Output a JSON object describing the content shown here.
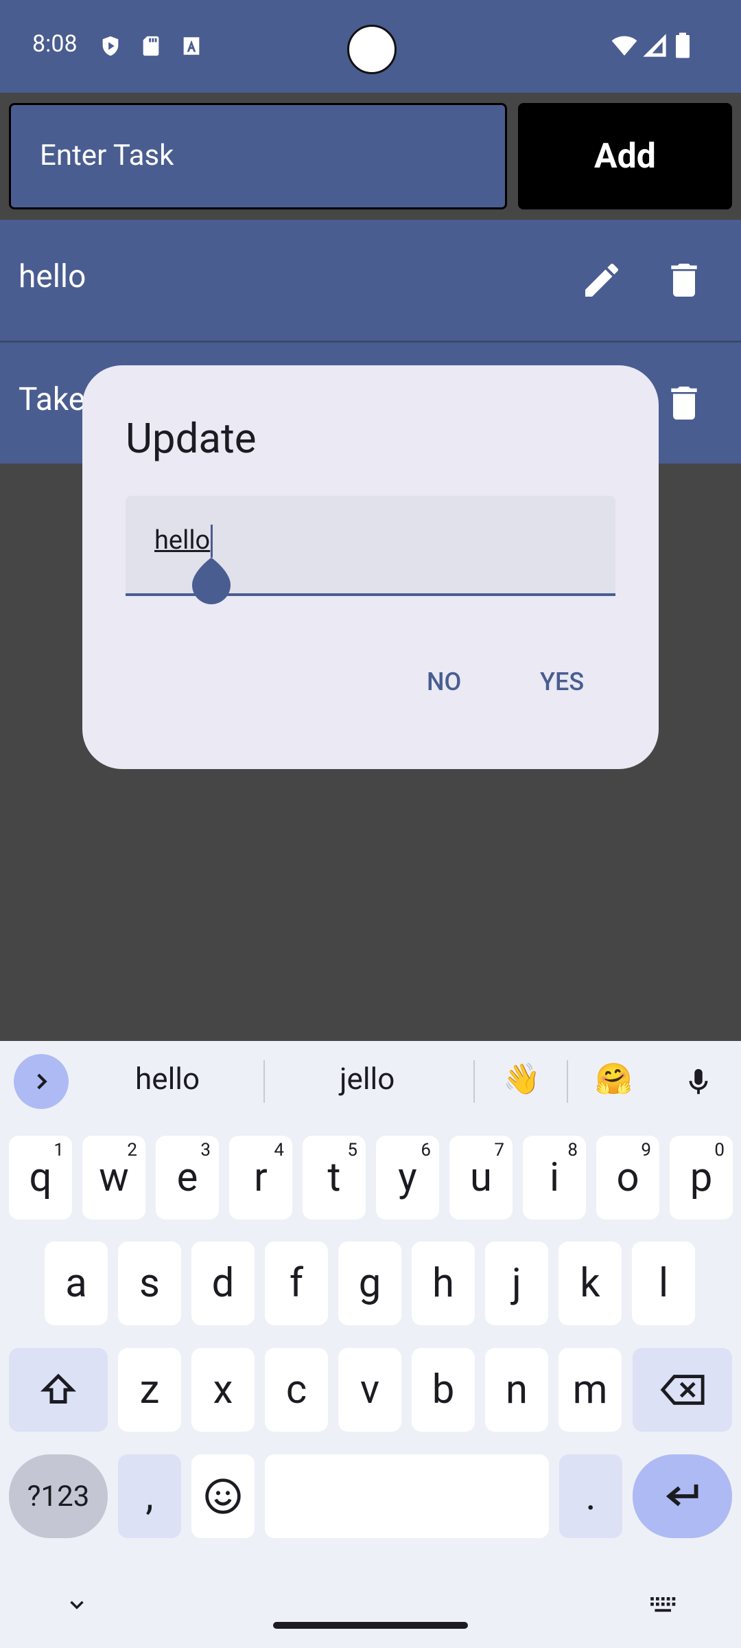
{
  "status_bar": {
    "time": "8:08"
  },
  "top": {
    "task_placeholder": "Enter Task",
    "add_label": "Add"
  },
  "tasks": [
    {
      "label": "hello"
    },
    {
      "label": "Take"
    }
  ],
  "dialog": {
    "title": "Update",
    "field_value": "hello",
    "no_label": "NO",
    "yes_label": "YES"
  },
  "keyboard": {
    "suggestions": [
      "hello",
      "jello"
    ],
    "emoji_suggestions": [
      "👋",
      "🤗"
    ],
    "row1": [
      {
        "k": "q",
        "s": "1"
      },
      {
        "k": "w",
        "s": "2"
      },
      {
        "k": "e",
        "s": "3"
      },
      {
        "k": "r",
        "s": "4"
      },
      {
        "k": "t",
        "s": "5"
      },
      {
        "k": "y",
        "s": "6"
      },
      {
        "k": "u",
        "s": "7"
      },
      {
        "k": "i",
        "s": "8"
      },
      {
        "k": "o",
        "s": "9"
      },
      {
        "k": "p",
        "s": "0"
      }
    ],
    "row2": [
      "a",
      "s",
      "d",
      "f",
      "g",
      "h",
      "j",
      "k",
      "l"
    ],
    "row3": [
      "z",
      "x",
      "c",
      "v",
      "b",
      "n",
      "m"
    ],
    "symbols_label": "?123",
    "comma": ",",
    "period": "."
  },
  "colors": {
    "primary": "#4a5d91",
    "scrim": "#464646",
    "dialog_bg": "#eae9f4"
  }
}
